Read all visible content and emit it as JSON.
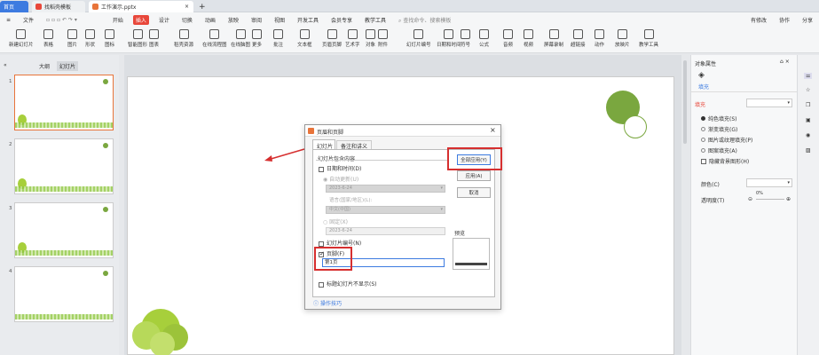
{
  "tabs": {
    "home": "首页",
    "template": "找稻壳模板",
    "doc": "工作演示.pptx",
    "add": "+"
  },
  "menu": {
    "file": "文件",
    "items": [
      "开始",
      "插入",
      "设计",
      "切换",
      "动画",
      "放映",
      "审阅",
      "视图",
      "开发工具",
      "会员专享",
      "教学工具"
    ],
    "active": "插入",
    "search_placeholder": "查找命令、搜索模板",
    "right": [
      "有修改",
      "协作",
      "分享"
    ]
  },
  "toolbar": {
    "items": [
      "新建幻灯片",
      "表格",
      "图片",
      "形状",
      "图标",
      "智能图形",
      "图表",
      "稻壳资源",
      "在线流程图",
      "在线脑图",
      "更多",
      "批注",
      "文本框",
      "页眉页脚",
      "艺术字",
      "对象",
      "附件",
      "幻灯片编号",
      "日期和时间",
      "符号",
      "公式",
      "音频",
      "视频",
      "屏幕录制",
      "超链接",
      "动作",
      "放映片",
      "教学工具"
    ]
  },
  "leftpane": {
    "tab_outline": "大纲",
    "tab_slides": "幻灯片",
    "slides": [
      "1",
      "2",
      "3",
      "4"
    ]
  },
  "dialog": {
    "title": "页眉和页脚",
    "tab1": "幻灯片",
    "tab2": "备注和讲义",
    "group": "幻灯片包含内容",
    "datetime": "日期和时间(D)",
    "auto_update": "自动更新(U)",
    "auto_date": "2023-6-24",
    "language": "语言(国家/地区)(L):",
    "lang_value": "中文(中国)",
    "fixed": "固定(X)",
    "fixed_date": "2023-6-24",
    "slide_number": "幻灯片编号(N)",
    "footer": "页脚(F)",
    "footer_value": "第1页",
    "hide_title": "标题幻灯片不显示(S)",
    "tips": "操作技巧",
    "apply_all": "全部应用(Y)",
    "apply": "应用(A)",
    "cancel": "取消",
    "preview": "预览",
    "close": "×"
  },
  "rightpane": {
    "title": "对象属性",
    "tab": "填充",
    "section": "填充",
    "options": [
      "纯色填充(S)",
      "渐变填充(G)",
      "图片或纹理填充(P)",
      "图案填充(A)",
      "隐藏背景图形(H)"
    ],
    "color_label": "颜色(C)",
    "transparency_label": "透明度(T)",
    "transparency_value": "0%"
  },
  "colors": {
    "accent": "#e8473a",
    "highlight": "#d62f2f",
    "green": "#7aa73f"
  }
}
